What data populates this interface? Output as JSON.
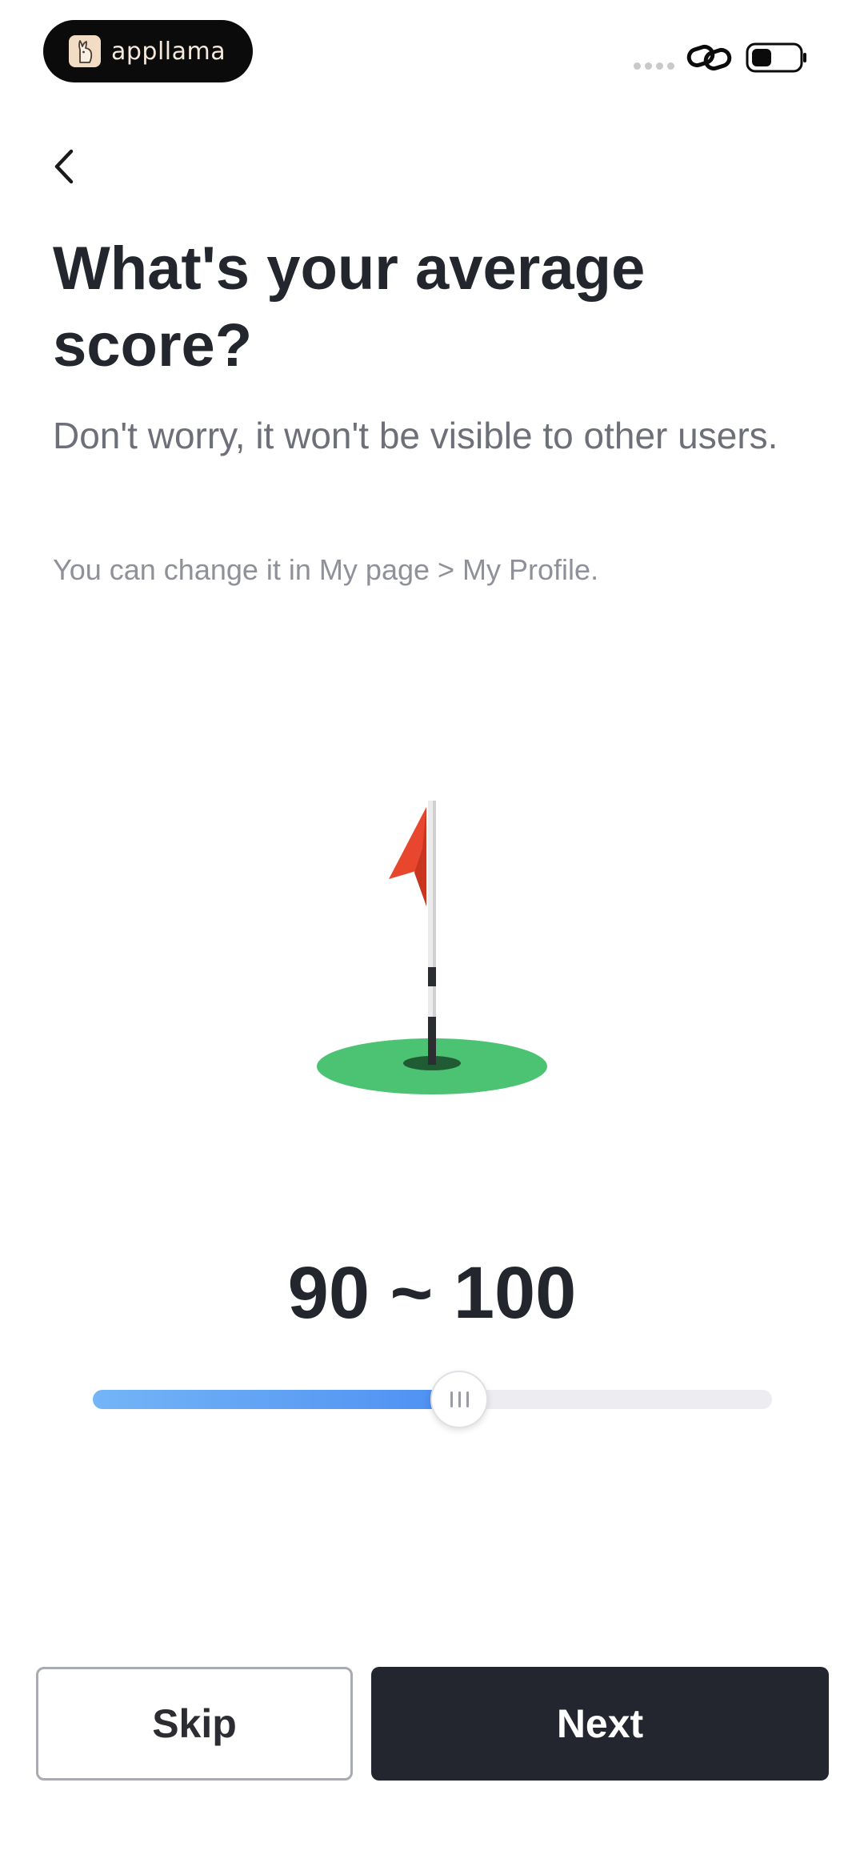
{
  "status_bar": {
    "app_name": "appllama",
    "app_icon": "llama-logo-icon",
    "indicators": [
      "signal-dots-icon",
      "link-icon",
      "battery-icon"
    ]
  },
  "header": {
    "back_icon": "chevron-left-icon"
  },
  "content": {
    "title": "What's your average score?",
    "subtitle": "Don't worry, it won't be visible to other users.",
    "hint": "You can change it in My page > My Profile.",
    "illustration": "golf-flag-green-icon"
  },
  "score_slider": {
    "value_label": "90 ~ 100",
    "position_fraction": 0.54,
    "fill_color": "#4d8ff2"
  },
  "actions": {
    "skip_label": "Skip",
    "next_label": "Next"
  },
  "colors": {
    "primary_dark": "#23262e",
    "flag_red": "#e8472e",
    "green": "#4cc273"
  }
}
